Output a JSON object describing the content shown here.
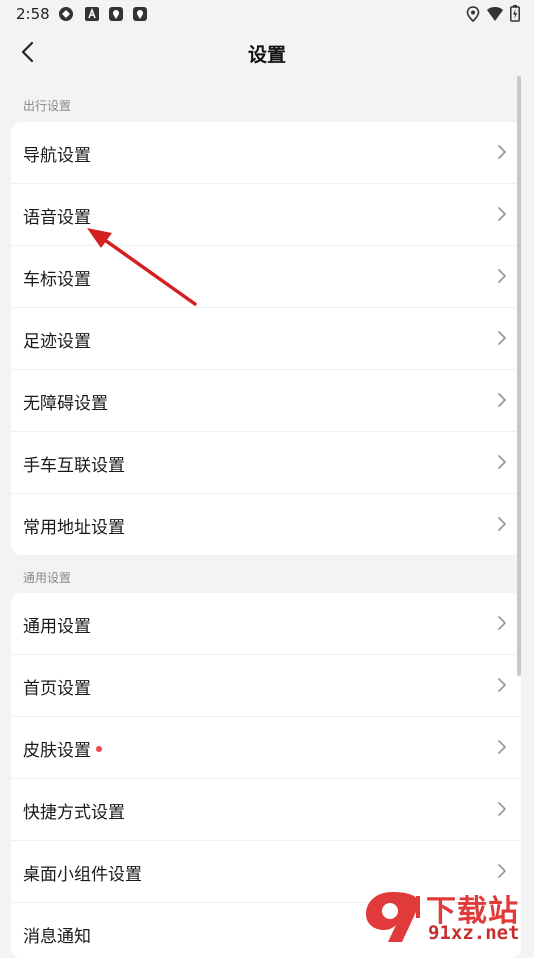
{
  "status_bar": {
    "time": "2:58"
  },
  "header": {
    "title": "设置"
  },
  "sections": [
    {
      "title": "出行设置",
      "items": [
        {
          "label": "导航设置"
        },
        {
          "label": "语音设置"
        },
        {
          "label": "车标设置"
        },
        {
          "label": "足迹设置"
        },
        {
          "label": "无障碍设置"
        },
        {
          "label": "手车互联设置"
        },
        {
          "label": "常用地址设置"
        }
      ]
    },
    {
      "title": "通用设置",
      "items": [
        {
          "label": "通用设置"
        },
        {
          "label": "首页设置"
        },
        {
          "label": "皮肤设置",
          "has_dot": true
        },
        {
          "label": "快捷方式设置"
        },
        {
          "label": "桌面小组件设置"
        },
        {
          "label": "消息通知"
        }
      ]
    }
  ],
  "watermark": {
    "text": "下载站",
    "url": "91xz.net"
  },
  "colors": {
    "accent_dot": "#f04848",
    "annotation_arrow": "#d42020"
  }
}
